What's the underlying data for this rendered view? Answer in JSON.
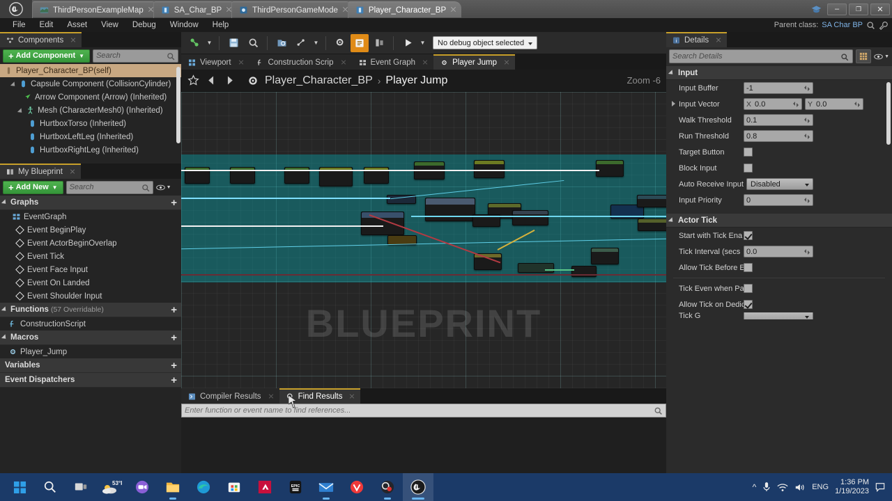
{
  "window": {
    "tabs": [
      {
        "label": "ThirdPersonExampleMap",
        "icon": "map-icon",
        "active": false
      },
      {
        "label": "SA_Char_BP",
        "icon": "blueprint-icon",
        "active": false
      },
      {
        "label": "ThirdPersonGameMode",
        "icon": "gamemode-icon",
        "active": false
      },
      {
        "label": "Player_Character_BP",
        "icon": "blueprint-icon",
        "active": true
      }
    ],
    "controls": {
      "minimize": "–",
      "maximize": "❐",
      "close": "✕"
    }
  },
  "menubar": {
    "items": [
      "File",
      "Edit",
      "Asset",
      "View",
      "Debug",
      "Window",
      "Help"
    ],
    "parent_class_label": "Parent class:",
    "parent_class_value": "SA Char BP"
  },
  "components_panel": {
    "tab_label": "Components",
    "add_button": "Add Component",
    "search_placeholder": "Search",
    "items": [
      {
        "label": "Player_Character_BP(self)",
        "indent": 0,
        "icon": "self-icon",
        "selected": true,
        "arrow": false
      },
      {
        "label": "Capsule Component (CollisionCylinder)",
        "indent": 1,
        "icon": "capsule-icon",
        "selected": false,
        "arrow": true
      },
      {
        "label": "Arrow Component (Arrow) (Inherited)",
        "indent": 2,
        "icon": "arrow-icon",
        "selected": false,
        "arrow": false
      },
      {
        "label": "Mesh (CharacterMesh0) (Inherited)",
        "indent": 2,
        "icon": "mesh-icon",
        "selected": false,
        "arrow": true
      },
      {
        "label": "HurtboxTorso (Inherited)",
        "indent": 3,
        "icon": "capsule-icon",
        "selected": false,
        "arrow": false
      },
      {
        "label": "HurtboxLeftLeg (Inherited)",
        "indent": 3,
        "icon": "capsule-icon",
        "selected": false,
        "arrow": false
      },
      {
        "label": "HurtboxRightLeg (Inherited)",
        "indent": 3,
        "icon": "capsule-icon",
        "selected": false,
        "arrow": false
      }
    ]
  },
  "my_blueprint_panel": {
    "tab_label": "My Blueprint",
    "add_button": "Add New",
    "search_placeholder": "Search",
    "sections": [
      {
        "title": "Graphs",
        "count": "",
        "has_plus": true,
        "graph": {
          "label": "EventGraph",
          "icon": "eventgraph-icon"
        },
        "events": [
          "Event BeginPlay",
          "Event ActorBeginOverlap",
          "Event Tick",
          "Event Face Input",
          "Event On Landed",
          "Event Shoulder Input"
        ]
      },
      {
        "title": "Functions",
        "count": "(57 Overridable)",
        "has_plus": true,
        "items": [
          {
            "label": "ConstructionScript",
            "icon": "function-icon"
          }
        ]
      },
      {
        "title": "Macros",
        "count": "",
        "has_plus": true,
        "items": [
          {
            "label": "Player_Jump",
            "icon": "macro-icon"
          }
        ]
      },
      {
        "title": "Variables",
        "count": "",
        "has_plus": true,
        "items": []
      },
      {
        "title": "Event Dispatchers",
        "count": "",
        "has_plus": true,
        "items": []
      }
    ]
  },
  "bp_toolbar": {
    "icons": [
      "compile-icon",
      "save-icon",
      "browse-icon",
      "find-in-bp-icon",
      "class-settings-icon",
      "class-defaults-icon",
      "simulation-icon",
      "play-icon"
    ],
    "debug_object": "No debug object selected"
  },
  "graph_tabs": [
    {
      "label": "Viewport",
      "icon": "viewport-icon",
      "active": false
    },
    {
      "label": "Construction Scrip",
      "icon": "function-icon",
      "active": false
    },
    {
      "label": "Event Graph",
      "icon": "eventgraph-icon",
      "active": false
    },
    {
      "label": "Player Jump",
      "icon": "macro-icon",
      "active": true
    }
  ],
  "breadcrumb": {
    "root": "Player_Character_BP",
    "separator": "›",
    "current": "Player Jump",
    "zoom_label": "Zoom",
    "zoom_value": "-6",
    "watermark": "BLUEPRINT"
  },
  "bottom_panel": {
    "tabs": [
      {
        "label": "Compiler Results",
        "icon": "compiler-icon",
        "active": false
      },
      {
        "label": "Find Results",
        "icon": "find-icon",
        "active": true
      }
    ],
    "find_placeholder": "Enter function or event name to find references..."
  },
  "details_panel": {
    "tab_label": "Details",
    "search_placeholder": "Search Details",
    "categories": [
      {
        "name": "Input",
        "properties": [
          {
            "label": "Input Buffer",
            "type": "number",
            "value": "-1"
          },
          {
            "label": "Input Vector",
            "type": "vector2",
            "x_axis": "X",
            "x_value": "0.0",
            "y_axis": "Y",
            "y_value": "0.0",
            "expandable": true
          },
          {
            "label": "Walk Threshold",
            "type": "number",
            "value": "0.1"
          },
          {
            "label": "Run Threshold",
            "type": "number",
            "value": "0.8"
          },
          {
            "label": "Target Button",
            "type": "checkbox",
            "checked": false
          },
          {
            "label": "Block Input",
            "type": "checkbox",
            "checked": false
          },
          {
            "label": "Auto Receive Input",
            "type": "combo",
            "value": "Disabled"
          },
          {
            "label": "Input Priority",
            "type": "number",
            "value": "0"
          }
        ]
      },
      {
        "name": "Actor Tick",
        "properties": [
          {
            "label": "Start with Tick Ena",
            "type": "checkbox",
            "checked": true
          },
          {
            "label": "Tick Interval (secs",
            "type": "number",
            "value": "0.0"
          },
          {
            "label": "Allow Tick Before E",
            "type": "checkbox",
            "checked": false
          },
          {
            "label": "Tick Even when Pa",
            "type": "checkbox",
            "checked": false,
            "divider_before": true
          },
          {
            "label": "Allow Tick on Dedic",
            "type": "checkbox",
            "checked": true
          },
          {
            "label": "Tick G",
            "type": "combo",
            "value": "",
            "clipped": true
          }
        ]
      }
    ]
  },
  "taskbar": {
    "icons": [
      "windows-start-icon",
      "search-icon",
      "task-view-icon",
      "weather-icon",
      "teams-icon",
      "file-explorer-icon",
      "edge-icon",
      "store-icon",
      "amd-icon",
      "epic-games-icon",
      "mail-icon",
      "vivaldi-icon",
      "obs-icon",
      "unreal-engine-icon"
    ],
    "weather_temp": "53°F",
    "language": "ENG",
    "time": "1:36 PM",
    "date": "1/19/2023"
  },
  "colors": {
    "accent_orange": "#e08b17",
    "green_button": "#3f9f3f",
    "selection_teal": "#00bec8",
    "taskbar_blue": "#1b3a68",
    "tab_highlight": "#c8a02a"
  },
  "chart_data": null
}
